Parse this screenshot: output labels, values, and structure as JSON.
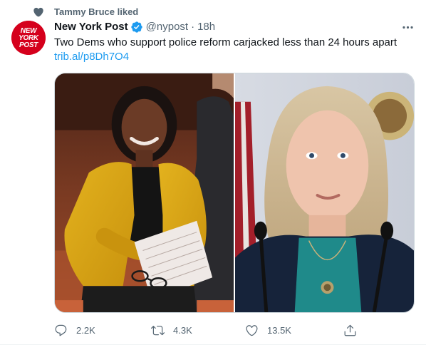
{
  "social_context": {
    "icon": "heart-icon",
    "text": "Tammy Bruce liked"
  },
  "author": {
    "display_name": "New York Post",
    "verified": true,
    "handle": "@nypost",
    "separator": "·",
    "time": "18h",
    "avatar_text": [
      "NEW",
      "YORK",
      "POST"
    ],
    "avatar_color": "#d5001c"
  },
  "tweet": {
    "text": "Two Dems who support police reform carjacked less than 24 hours apart",
    "link": "trib.al/p8Dh7O4"
  },
  "actions": {
    "reply_count": "2.2K",
    "retweet_count": "4.3K",
    "like_count": "13.5K"
  },
  "colors": {
    "accent": "#1d9bf0",
    "secondary_text": "#536471",
    "primary_text": "#0f1419"
  }
}
